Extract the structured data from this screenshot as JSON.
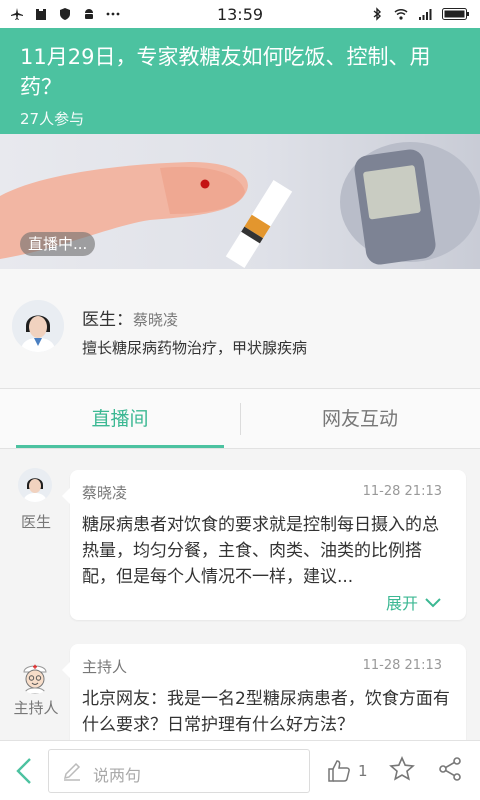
{
  "status": {
    "time": "13:59",
    "left_icons": [
      "airplane-icon",
      "clipboard-icon",
      "shield-icon",
      "android-icon",
      "more-icon"
    ],
    "right_icons": [
      "bluetooth-icon",
      "wifi-icon",
      "signal-icon",
      "battery-icon"
    ]
  },
  "header": {
    "title": "11月29日，专家教糖友如何吃饭、控制、用药？",
    "participants": "27人参与"
  },
  "banner": {
    "live_badge": "直播中..."
  },
  "doctor": {
    "label": "医生：",
    "name": "蔡晓凌",
    "specialty": "擅长糖尿病药物治疗，甲状腺疾病"
  },
  "tabs": [
    {
      "label": "直播间",
      "active": true
    },
    {
      "label": "网友互动",
      "active": false
    }
  ],
  "messages": [
    {
      "role": "医生",
      "name": "蔡晓凌",
      "time": "11-28 21:13",
      "text": "糖尿病患者对饮食的要求就是控制每日摄入的总热量，均匀分餐，主食、肉类、油类的比例搭配，但是每个人情况不一样，建议...",
      "expand_label": "展开"
    },
    {
      "role": "主持人",
      "name": "主持人",
      "time": "11-28 21:13",
      "text": "北京网友：我是一名2型糖尿病患者，饮食方面有什么要求？日常护理有什么好方法？"
    }
  ],
  "bottom": {
    "comment_placeholder": "说两句",
    "like_count": "1"
  },
  "colors": {
    "accent": "#4cc2a0",
    "accent_text": "#3cb893"
  }
}
